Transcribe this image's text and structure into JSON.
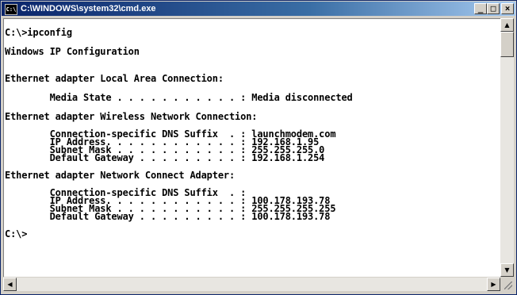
{
  "window": {
    "title": "C:\\WINDOWS\\system32\\cmd.exe",
    "icon_label": "C:\\",
    "minimize_glyph": "_",
    "maximize_glyph": "□",
    "close_glyph": "×"
  },
  "console": {
    "lines": [
      "C:\\>ipconfig",
      "",
      "Windows IP Configuration",
      "",
      "",
      "Ethernet adapter Local Area Connection:",
      "",
      "        Media State . . . . . . . . . . . : Media disconnected",
      "",
      "Ethernet adapter Wireless Network Connection:",
      "",
      "        Connection-specific DNS Suffix  . : launchmodem.com",
      "        IP Address. . . . . . . . . . . . : 192.168.1.95",
      "        Subnet Mask . . . . . . . . . . . : 255.255.255.0",
      "        Default Gateway . . . . . . . . . : 192.168.1.254",
      "",
      "Ethernet adapter Network Connect Adapter:",
      "",
      "        Connection-specific DNS Suffix  . :",
      "        IP Address. . . . . . . . . . . . : 100.178.193.78",
      "        Subnet Mask . . . . . . . . . . . : 255.255.255.255",
      "        Default Gateway . . . . . . . . . : 100.178.193.78",
      "",
      "C:\\>"
    ]
  },
  "scrollbars": {
    "up_glyph": "▲",
    "down_glyph": "▼",
    "left_glyph": "◀",
    "right_glyph": "▶"
  }
}
